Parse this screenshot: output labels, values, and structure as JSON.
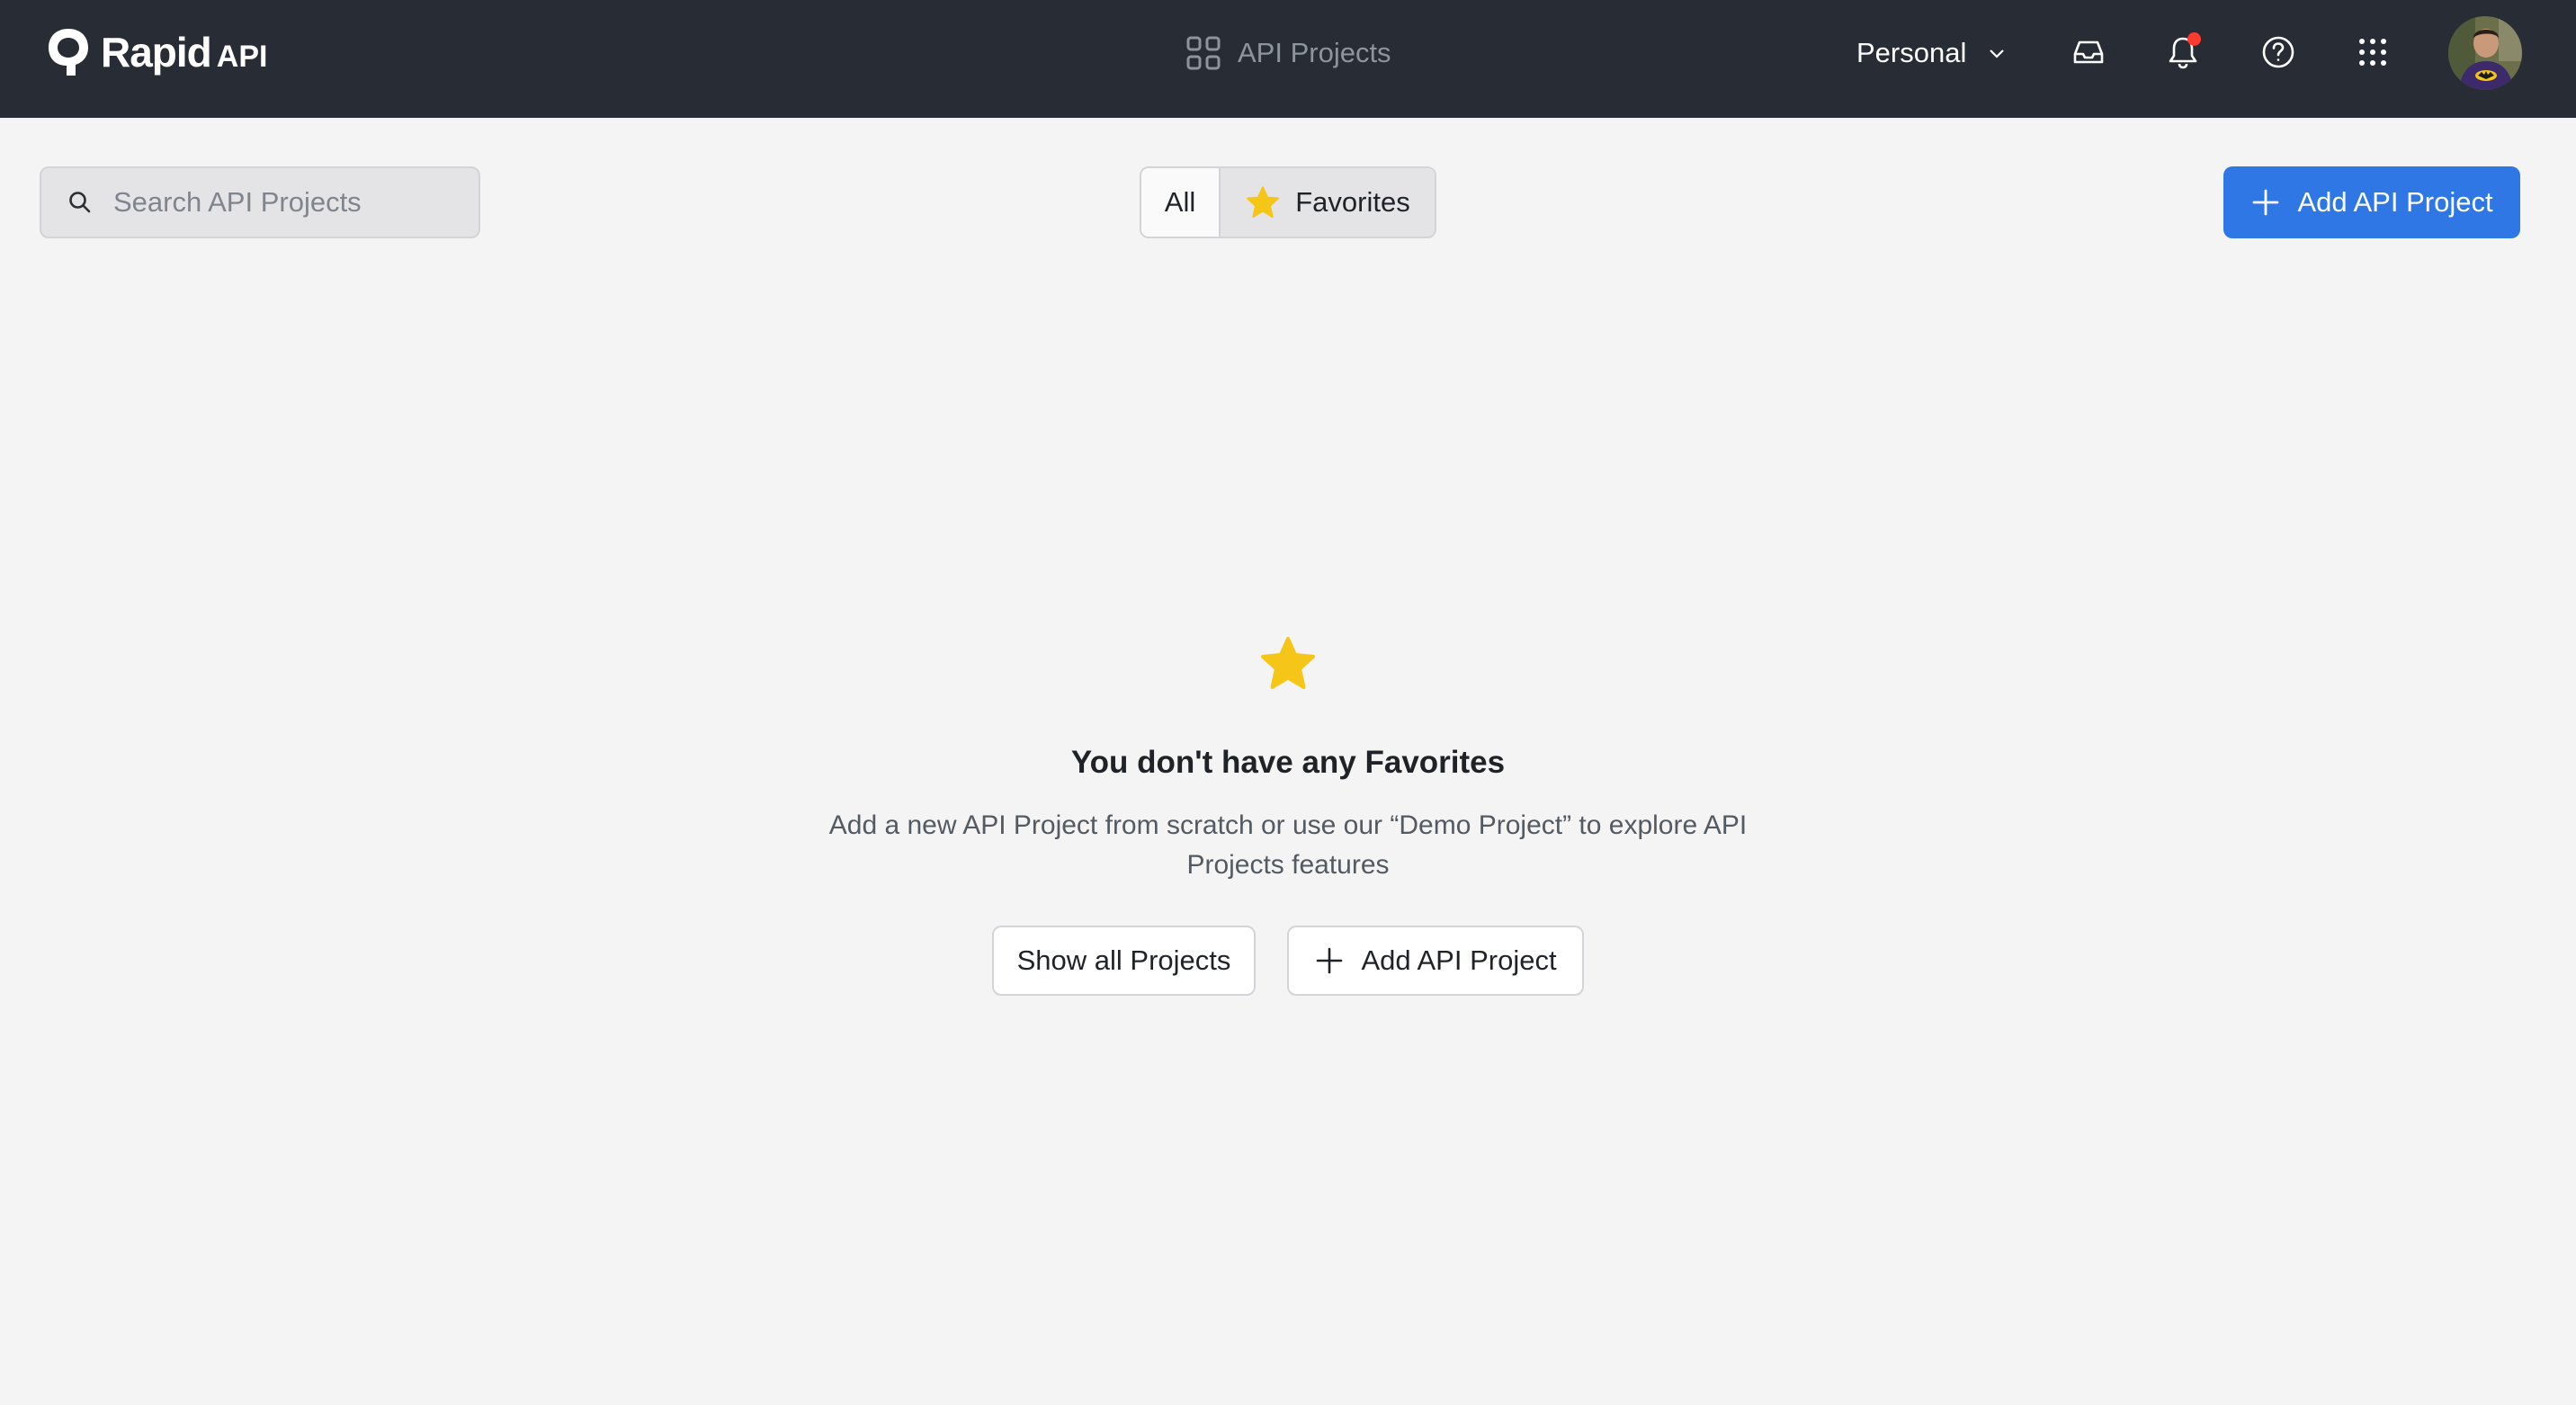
{
  "header": {
    "logo_text": "Rapid",
    "logo_suffix": "API",
    "section_title": "API Projects",
    "workspace_label": "Personal",
    "notification_badge_color": "#ff3b30",
    "icons": [
      "inbox-icon",
      "bell-icon",
      "help-icon",
      "apps-grid-icon"
    ]
  },
  "toolbar": {
    "search_placeholder": "Search API Projects",
    "search_value": "",
    "filters": [
      {
        "label": "All",
        "selected": false
      },
      {
        "label": "Favorites",
        "selected": true,
        "icon": "star-icon"
      }
    ],
    "add_button_label": "Add API Project",
    "accent_color": "#2f77e4"
  },
  "empty_state": {
    "icon": "star-icon",
    "title": "You don't have any Favorites",
    "description": "Add a new API Project from scratch or use our “Demo Project” to explore API Projects features",
    "show_all_label": "Show all Projects",
    "add_label": "Add API Project",
    "star_color": "#f5c518"
  }
}
